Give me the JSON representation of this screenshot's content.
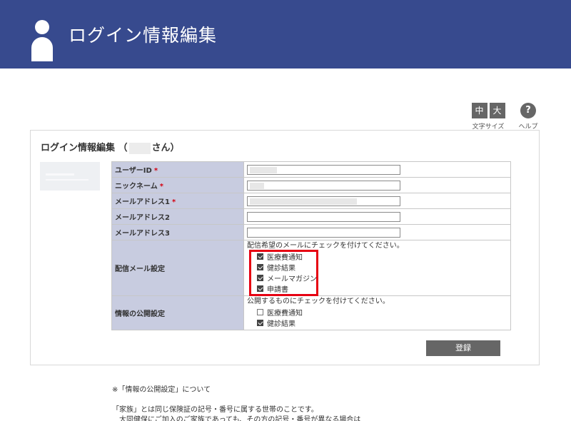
{
  "header": {
    "title": "ログイン情報編集",
    "bg_color": "#374a8e"
  },
  "controls": {
    "font_size": {
      "medium": "中",
      "large": "大",
      "caption": "文字サイズ"
    },
    "help": {
      "symbol": "?",
      "caption": "ヘルプ"
    }
  },
  "panel": {
    "title_prefix": "ログイン情報編集 （",
    "title_suffix": "さん）"
  },
  "form": {
    "required_mark": "*",
    "rows": {
      "user_id": {
        "label": "ユーザーID"
      },
      "nickname": {
        "label": "ニックネーム"
      },
      "email1": {
        "label": "メールアドレス1"
      },
      "email2": {
        "label": "メールアドレス2"
      },
      "email3": {
        "label": "メールアドレス3"
      }
    },
    "mail_settings": {
      "label": "配信メール設定",
      "note": "配信希望のメールにチェックを付けてください。",
      "options": [
        {
          "label": "医療費通知",
          "checked": true
        },
        {
          "label": "健診結果",
          "checked": true
        },
        {
          "label": "メールマガジン",
          "checked": true
        },
        {
          "label": "申請書",
          "checked": true
        }
      ]
    },
    "public_settings": {
      "label": "情報の公開設定",
      "note": "公開するものにチェックを付けてください。",
      "options": [
        {
          "label": "医療費通知",
          "checked": false
        },
        {
          "label": "健診結果",
          "checked": true
        }
      ]
    },
    "submit_label": "登録",
    "highlight_color": "#e60012"
  },
  "footer": {
    "note_title": "※「情報の公開設定」について",
    "line1": "「家族」とは同じ保険証の記号・番号に属する世帯のことです。",
    "line2": "大同健保にご加入のご家族であっても、その方の記号・番号が異なる場合は"
  }
}
